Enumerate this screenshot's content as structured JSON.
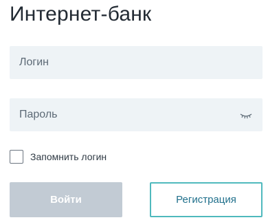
{
  "header": {
    "title": "Интернет-банк"
  },
  "form": {
    "login_placeholder": "Логин",
    "password_placeholder": "Пароль",
    "password_toggle_icon": "eye-closed-icon",
    "remember_label": "Запомнить логин",
    "remember_checked": false
  },
  "actions": {
    "login_label": "Войти",
    "register_label": "Регистрация"
  },
  "colors": {
    "field_bg": "#eef3f6",
    "login_button_bg": "#c2cbd4",
    "register_border": "#4fb9bd",
    "register_text": "#1f6f8b"
  }
}
